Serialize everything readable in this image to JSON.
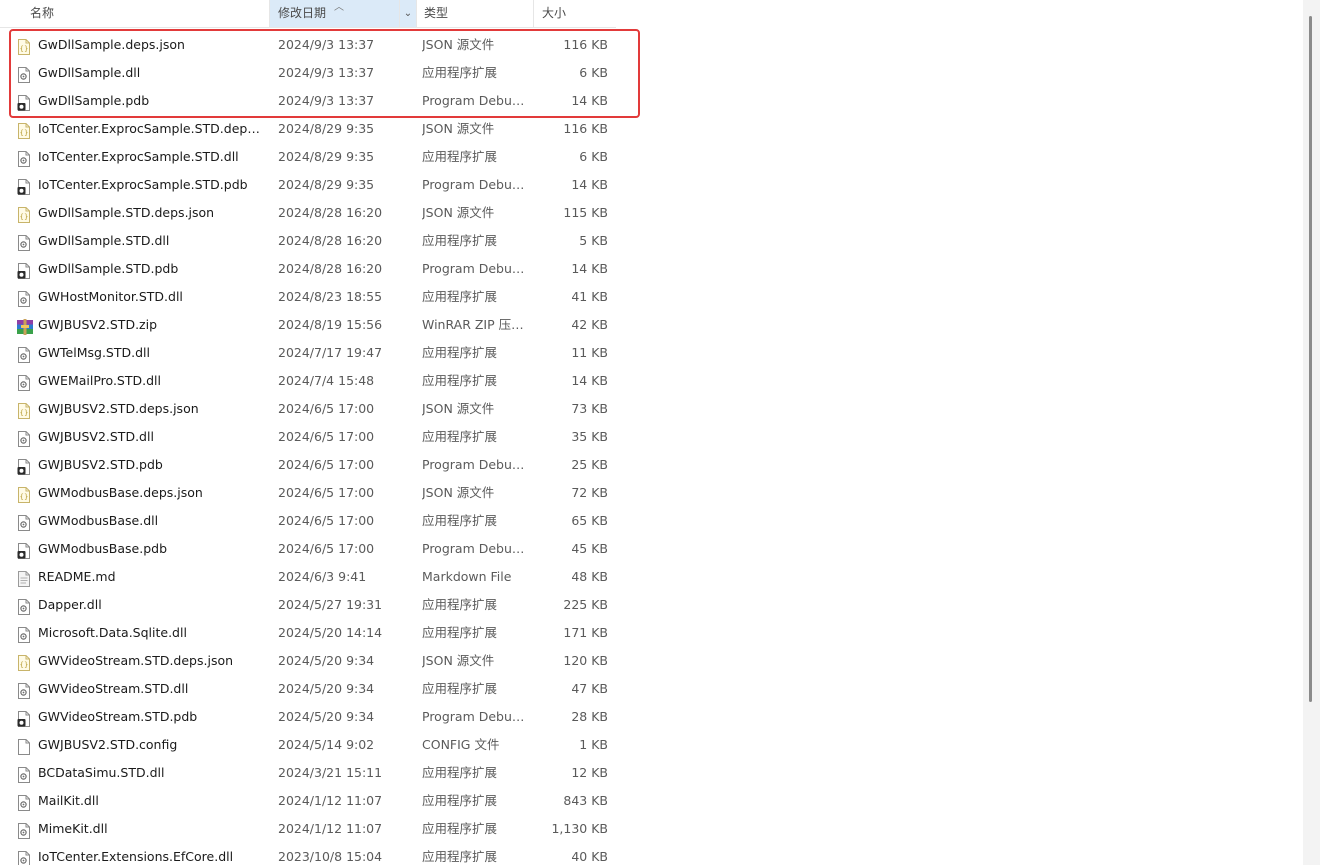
{
  "columns": {
    "name": "名称",
    "date": "修改日期",
    "type": "类型",
    "size": "大小"
  },
  "icons": {
    "json": "json-file-icon",
    "dll": "dll-file-icon",
    "pdb": "pdb-file-icon",
    "zip": "winrar-zip-icon",
    "md": "markdown-file-icon",
    "config": "config-file-icon"
  },
  "colors": {
    "highlight": "#e23a3a",
    "sorted_header": "#dbeaf8"
  },
  "files": [
    {
      "name": "GwDllSample.deps.json",
      "date": "2024/9/3 13:37",
      "type": "JSON 源文件",
      "size": "116 KB",
      "kind": "json"
    },
    {
      "name": "GwDllSample.dll",
      "date": "2024/9/3 13:37",
      "type": "应用程序扩展",
      "size": "6 KB",
      "kind": "dll"
    },
    {
      "name": "GwDllSample.pdb",
      "date": "2024/9/3 13:37",
      "type": "Program Debug...",
      "size": "14 KB",
      "kind": "pdb"
    },
    {
      "name": "IoTCenter.ExprocSample.STD.deps.js...",
      "date": "2024/8/29 9:35",
      "type": "JSON 源文件",
      "size": "116 KB",
      "kind": "json"
    },
    {
      "name": "IoTCenter.ExprocSample.STD.dll",
      "date": "2024/8/29 9:35",
      "type": "应用程序扩展",
      "size": "6 KB",
      "kind": "dll"
    },
    {
      "name": "IoTCenter.ExprocSample.STD.pdb",
      "date": "2024/8/29 9:35",
      "type": "Program Debug...",
      "size": "14 KB",
      "kind": "pdb"
    },
    {
      "name": "GwDllSample.STD.deps.json",
      "date": "2024/8/28 16:20",
      "type": "JSON 源文件",
      "size": "115 KB",
      "kind": "json"
    },
    {
      "name": "GwDllSample.STD.dll",
      "date": "2024/8/28 16:20",
      "type": "应用程序扩展",
      "size": "5 KB",
      "kind": "dll"
    },
    {
      "name": "GwDllSample.STD.pdb",
      "date": "2024/8/28 16:20",
      "type": "Program Debug...",
      "size": "14 KB",
      "kind": "pdb"
    },
    {
      "name": "GWHostMonitor.STD.dll",
      "date": "2024/8/23 18:55",
      "type": "应用程序扩展",
      "size": "41 KB",
      "kind": "dll"
    },
    {
      "name": "GWJBUSV2.STD.zip",
      "date": "2024/8/19 15:56",
      "type": "WinRAR ZIP 压缩...",
      "size": "42 KB",
      "kind": "zip"
    },
    {
      "name": "GWTelMsg.STD.dll",
      "date": "2024/7/17 19:47",
      "type": "应用程序扩展",
      "size": "11 KB",
      "kind": "dll"
    },
    {
      "name": "GWEMailPro.STD.dll",
      "date": "2024/7/4 15:48",
      "type": "应用程序扩展",
      "size": "14 KB",
      "kind": "dll"
    },
    {
      "name": "GWJBUSV2.STD.deps.json",
      "date": "2024/6/5 17:00",
      "type": "JSON 源文件",
      "size": "73 KB",
      "kind": "json"
    },
    {
      "name": "GWJBUSV2.STD.dll",
      "date": "2024/6/5 17:00",
      "type": "应用程序扩展",
      "size": "35 KB",
      "kind": "dll"
    },
    {
      "name": "GWJBUSV2.STD.pdb",
      "date": "2024/6/5 17:00",
      "type": "Program Debug...",
      "size": "25 KB",
      "kind": "pdb"
    },
    {
      "name": "GWModbusBase.deps.json",
      "date": "2024/6/5 17:00",
      "type": "JSON 源文件",
      "size": "72 KB",
      "kind": "json"
    },
    {
      "name": "GWModbusBase.dll",
      "date": "2024/6/5 17:00",
      "type": "应用程序扩展",
      "size": "65 KB",
      "kind": "dll"
    },
    {
      "name": "GWModbusBase.pdb",
      "date": "2024/6/5 17:00",
      "type": "Program Debug...",
      "size": "45 KB",
      "kind": "pdb"
    },
    {
      "name": "README.md",
      "date": "2024/6/3 9:41",
      "type": "Markdown File",
      "size": "48 KB",
      "kind": "md"
    },
    {
      "name": "Dapper.dll",
      "date": "2024/5/27 19:31",
      "type": "应用程序扩展",
      "size": "225 KB",
      "kind": "dll"
    },
    {
      "name": "Microsoft.Data.Sqlite.dll",
      "date": "2024/5/20 14:14",
      "type": "应用程序扩展",
      "size": "171 KB",
      "kind": "dll"
    },
    {
      "name": "GWVideoStream.STD.deps.json",
      "date": "2024/5/20 9:34",
      "type": "JSON 源文件",
      "size": "120 KB",
      "kind": "json"
    },
    {
      "name": "GWVideoStream.STD.dll",
      "date": "2024/5/20 9:34",
      "type": "应用程序扩展",
      "size": "47 KB",
      "kind": "dll"
    },
    {
      "name": "GWVideoStream.STD.pdb",
      "date": "2024/5/20 9:34",
      "type": "Program Debug...",
      "size": "28 KB",
      "kind": "pdb"
    },
    {
      "name": "GWJBUSV2.STD.config",
      "date": "2024/5/14 9:02",
      "type": "CONFIG 文件",
      "size": "1 KB",
      "kind": "config"
    },
    {
      "name": "BCDataSimu.STD.dll",
      "date": "2024/3/21 15:11",
      "type": "应用程序扩展",
      "size": "12 KB",
      "kind": "dll"
    },
    {
      "name": "MailKit.dll",
      "date": "2024/1/12 11:07",
      "type": "应用程序扩展",
      "size": "843 KB",
      "kind": "dll"
    },
    {
      "name": "MimeKit.dll",
      "date": "2024/1/12 11:07",
      "type": "应用程序扩展",
      "size": "1,130 KB",
      "kind": "dll"
    },
    {
      "name": "IoTCenter.Extensions.EfCore.dll",
      "date": "2023/10/8 15:04",
      "type": "应用程序扩展",
      "size": "40 KB",
      "kind": "dll"
    }
  ]
}
